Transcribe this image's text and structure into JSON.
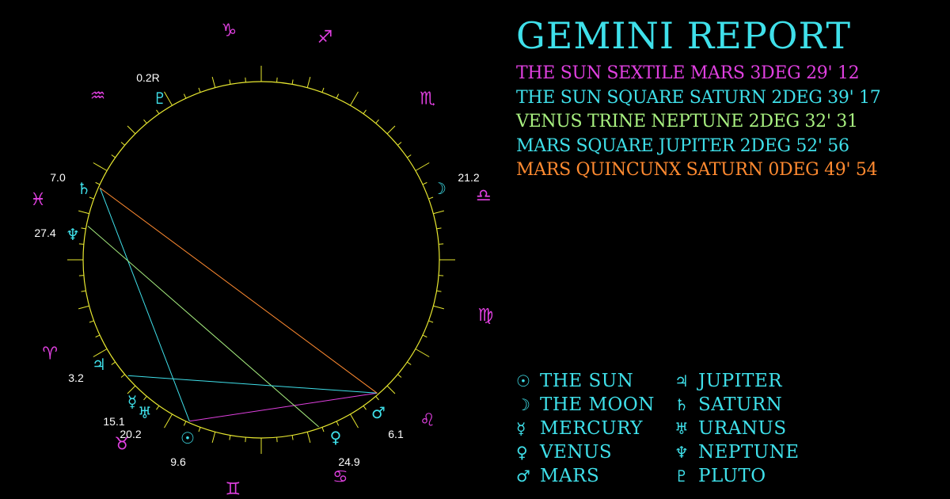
{
  "report": {
    "title": "GEMINI REPORT",
    "aspects": [
      {
        "text": "THE SUN SEXTILE MARS 3DEG 29' 12",
        "color": "#e040e0"
      },
      {
        "text": "THE SUN SQUARE SATURN 2DEG 39' 17",
        "color": "#3fe0ea"
      },
      {
        "text": "VENUS TRINE NEPTUNE 2DEG 32' 31",
        "color": "#a8f080"
      },
      {
        "text": "MARS SQUARE JUPITER 2DEG 52' 56",
        "color": "#3fe0ea"
      },
      {
        "text": "MARS QUINCUNX SATURN 0DEG 49' 54",
        "color": "#ff8a30"
      }
    ]
  },
  "legend": [
    {
      "glyph": "☉",
      "name": "THE SUN",
      "icon": "sun-icon"
    },
    {
      "glyph": "♃",
      "name": "JUPITER",
      "icon": "jupiter-icon"
    },
    {
      "glyph": "☽",
      "name": "THE MOON",
      "icon": "moon-icon"
    },
    {
      "glyph": "♄",
      "name": "SATURN",
      "icon": "saturn-icon"
    },
    {
      "glyph": "☿",
      "name": "MERCURY",
      "icon": "mercury-icon"
    },
    {
      "glyph": "♅",
      "name": "URANUS",
      "icon": "uranus-icon"
    },
    {
      "glyph": "♀",
      "name": "VENUS",
      "icon": "venus-icon"
    },
    {
      "glyph": "♆",
      "name": "NEPTUNE",
      "icon": "neptune-icon"
    },
    {
      "glyph": "♂",
      "name": "MARS",
      "icon": "mars-icon"
    },
    {
      "glyph": "♇",
      "name": "PLUTO",
      "icon": "pluto-icon"
    }
  ],
  "wheel": {
    "signs": [
      {
        "glyph": "♑",
        "name": "capricorn"
      },
      {
        "glyph": "♐",
        "name": "sagittarius"
      },
      {
        "glyph": "♏",
        "name": "scorpio"
      },
      {
        "glyph": "♎",
        "name": "libra"
      },
      {
        "glyph": "♍",
        "name": "virgo"
      },
      {
        "glyph": "♌",
        "name": "leo"
      },
      {
        "glyph": "♋",
        "name": "cancer"
      },
      {
        "glyph": "♊",
        "name": "gemini"
      },
      {
        "glyph": "♉",
        "name": "taurus"
      },
      {
        "glyph": "♈",
        "name": "aries"
      },
      {
        "glyph": "♓",
        "name": "pisces"
      },
      {
        "glyph": "♒",
        "name": "aquarius"
      }
    ],
    "planets": [
      {
        "name": "pluto",
        "glyph": "♇",
        "degree": "0.2R"
      },
      {
        "name": "moon",
        "glyph": "☽",
        "degree": "21.2"
      },
      {
        "name": "saturn",
        "glyph": "♄",
        "degree": "7.0"
      },
      {
        "name": "neptune",
        "glyph": "♆",
        "degree": "27.4"
      },
      {
        "name": "jupiter",
        "glyph": "♃",
        "degree": "3.2"
      },
      {
        "name": "mercury",
        "glyph": "☿",
        "degree": "15.1"
      },
      {
        "name": "uranus",
        "glyph": "♅",
        "degree": "20.2"
      },
      {
        "name": "sun",
        "glyph": "☉",
        "degree": "9.6"
      },
      {
        "name": "venus",
        "glyph": "♀",
        "degree": "24.9"
      },
      {
        "name": "mars",
        "glyph": "♂",
        "degree": "6.1"
      }
    ],
    "aspect_lines": [
      {
        "from": "sun",
        "to": "mars",
        "color": "#e040e0"
      },
      {
        "from": "sun",
        "to": "saturn",
        "color": "#3fe0ea"
      },
      {
        "from": "venus",
        "to": "neptune",
        "color": "#a8f080"
      },
      {
        "from": "mars",
        "to": "jupiter",
        "color": "#3fe0ea"
      },
      {
        "from": "mars",
        "to": "saturn",
        "color": "#ff8a30"
      }
    ],
    "colors": {
      "ring": "#e8e830",
      "sign": "#e040e0",
      "planet": "#3fe0ea",
      "degree": "#ffffff"
    }
  }
}
